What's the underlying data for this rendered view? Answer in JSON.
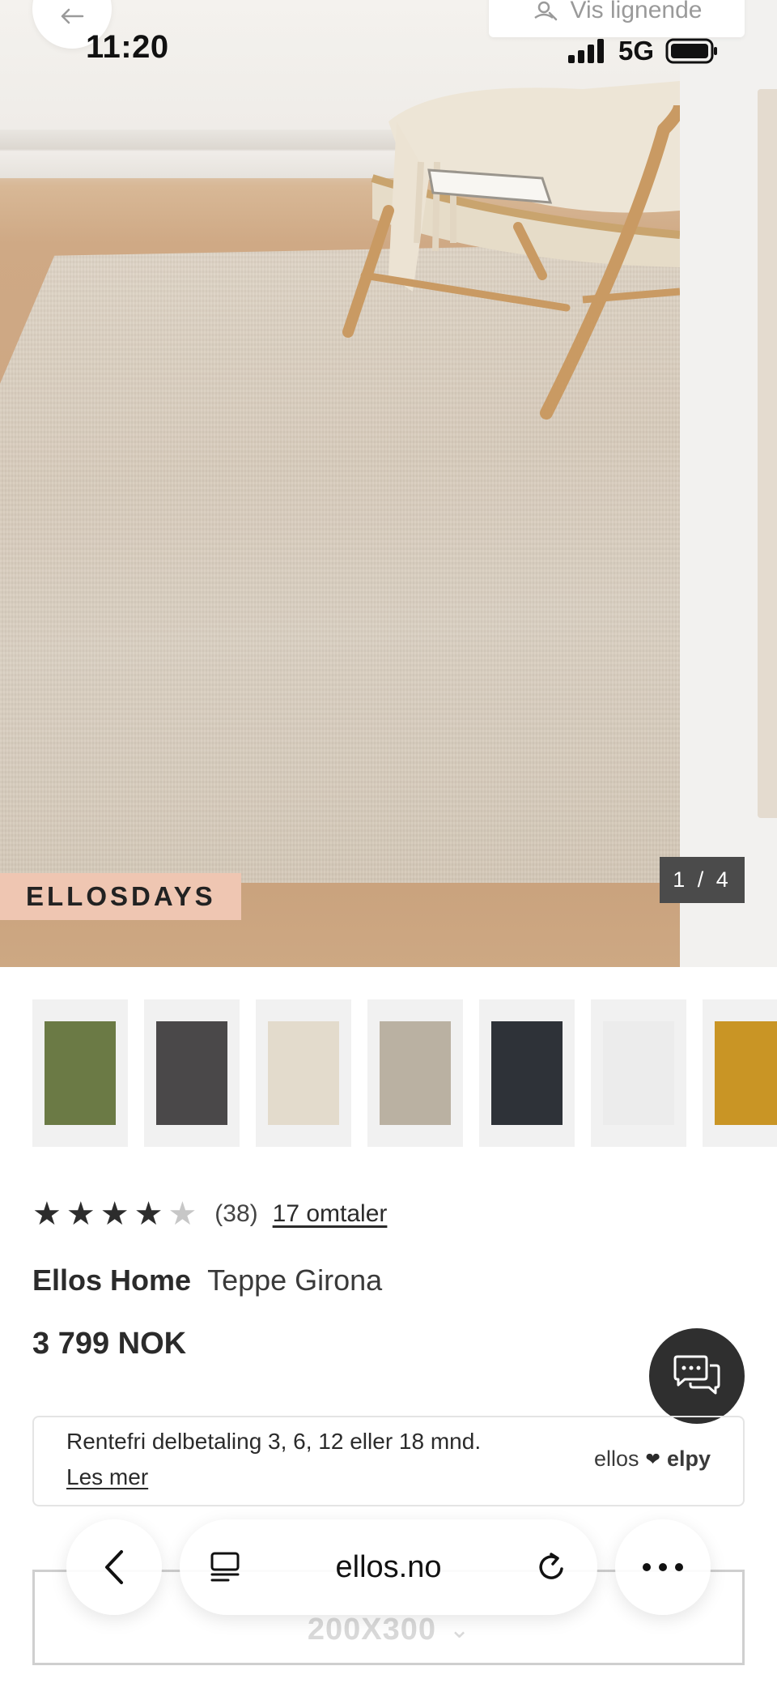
{
  "status_bar": {
    "time": "11:20",
    "network": "5G"
  },
  "top_actions": {
    "similar_label": "Vis lignende"
  },
  "gallery": {
    "promo_tag": "ELLOSDAYS",
    "counter": "1 / 4"
  },
  "swatches": [
    {
      "name": "green",
      "color": "#6b7a45"
    },
    {
      "name": "charcoal",
      "color": "#4a4849"
    },
    {
      "name": "cream",
      "color": "#e3dbcc"
    },
    {
      "name": "greige",
      "color": "#bab1a2"
    },
    {
      "name": "navy-black",
      "color": "#2e3238"
    },
    {
      "name": "white",
      "color": "#ececec"
    },
    {
      "name": "mustard",
      "color": "#c99525"
    }
  ],
  "product": {
    "rating": 4,
    "rating_max": 5,
    "rating_count": "(38)",
    "reviews_link": "17 omtaler",
    "brand": "Ellos Home",
    "name": "Teppe Girona",
    "price": "3 799 NOK"
  },
  "finance": {
    "text": "Rentefri delbetaling 3, 6, 12 eller 18 mnd.",
    "link": "Les mer",
    "logo_left": "ellos",
    "logo_right": "elpy"
  },
  "size_selector": {
    "value": "200X300"
  },
  "browser": {
    "url": "ellos.no"
  },
  "colors": {
    "promo_tag_bg": "#efc6b2",
    "counter_bg": "#4b4b4b",
    "chat_bg": "#2f2f2f"
  }
}
